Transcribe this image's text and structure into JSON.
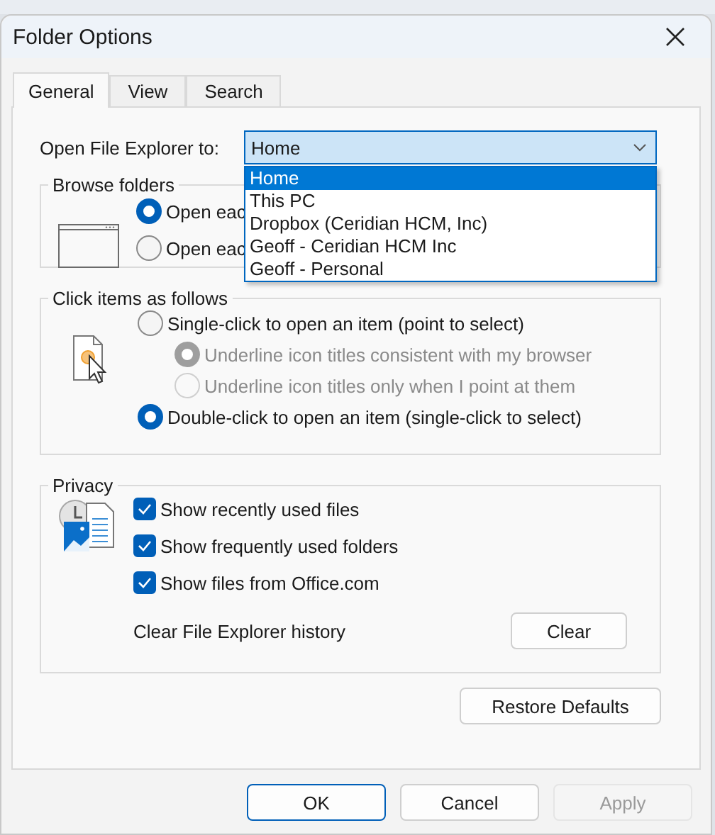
{
  "window": {
    "title": "Folder Options"
  },
  "tabs": [
    {
      "label": "General",
      "selected": true
    },
    {
      "label": "View",
      "selected": false
    },
    {
      "label": "Search",
      "selected": false
    }
  ],
  "open_to": {
    "label": "Open File Explorer to:",
    "value": "Home",
    "expanded": true,
    "options": [
      {
        "label": "Home",
        "selected": true
      },
      {
        "label": "This PC",
        "selected": false
      },
      {
        "label": "Dropbox (Ceridian HCM, Inc)",
        "selected": false
      },
      {
        "label": "Geoff - Ceridian HCM Inc",
        "selected": false
      },
      {
        "label": "Geoff - Personal",
        "selected": false
      }
    ]
  },
  "browse_folders": {
    "title": "Browse folders",
    "options": [
      {
        "label": "Open eac",
        "selected": true
      },
      {
        "label": "Open eac",
        "selected": false
      }
    ]
  },
  "click_items": {
    "title": "Click items as follows",
    "options": [
      {
        "label": "Single-click to open an item (point to select)",
        "selected": false,
        "children": [
          {
            "label": "Underline icon titles consistent with my browser",
            "selected": true,
            "disabled": true
          },
          {
            "label": "Underline icon titles only when I point at them",
            "selected": false,
            "disabled": true
          }
        ]
      },
      {
        "label": "Double-click to open an item (single-click to select)",
        "selected": true
      }
    ]
  },
  "privacy": {
    "title": "Privacy",
    "checkboxes": [
      {
        "label": "Show recently used files",
        "checked": true
      },
      {
        "label": "Show frequently used folders",
        "checked": true
      },
      {
        "label": "Show files from Office.com",
        "checked": true
      }
    ],
    "clear_label": "Clear File Explorer history",
    "clear_button": "Clear"
  },
  "restore_button": "Restore Defaults",
  "buttons": [
    {
      "label": "OK",
      "kind": "default",
      "disabled": false
    },
    {
      "label": "Cancel",
      "kind": "normal",
      "disabled": false
    },
    {
      "label": "Apply",
      "kind": "normal",
      "disabled": true
    }
  ]
}
